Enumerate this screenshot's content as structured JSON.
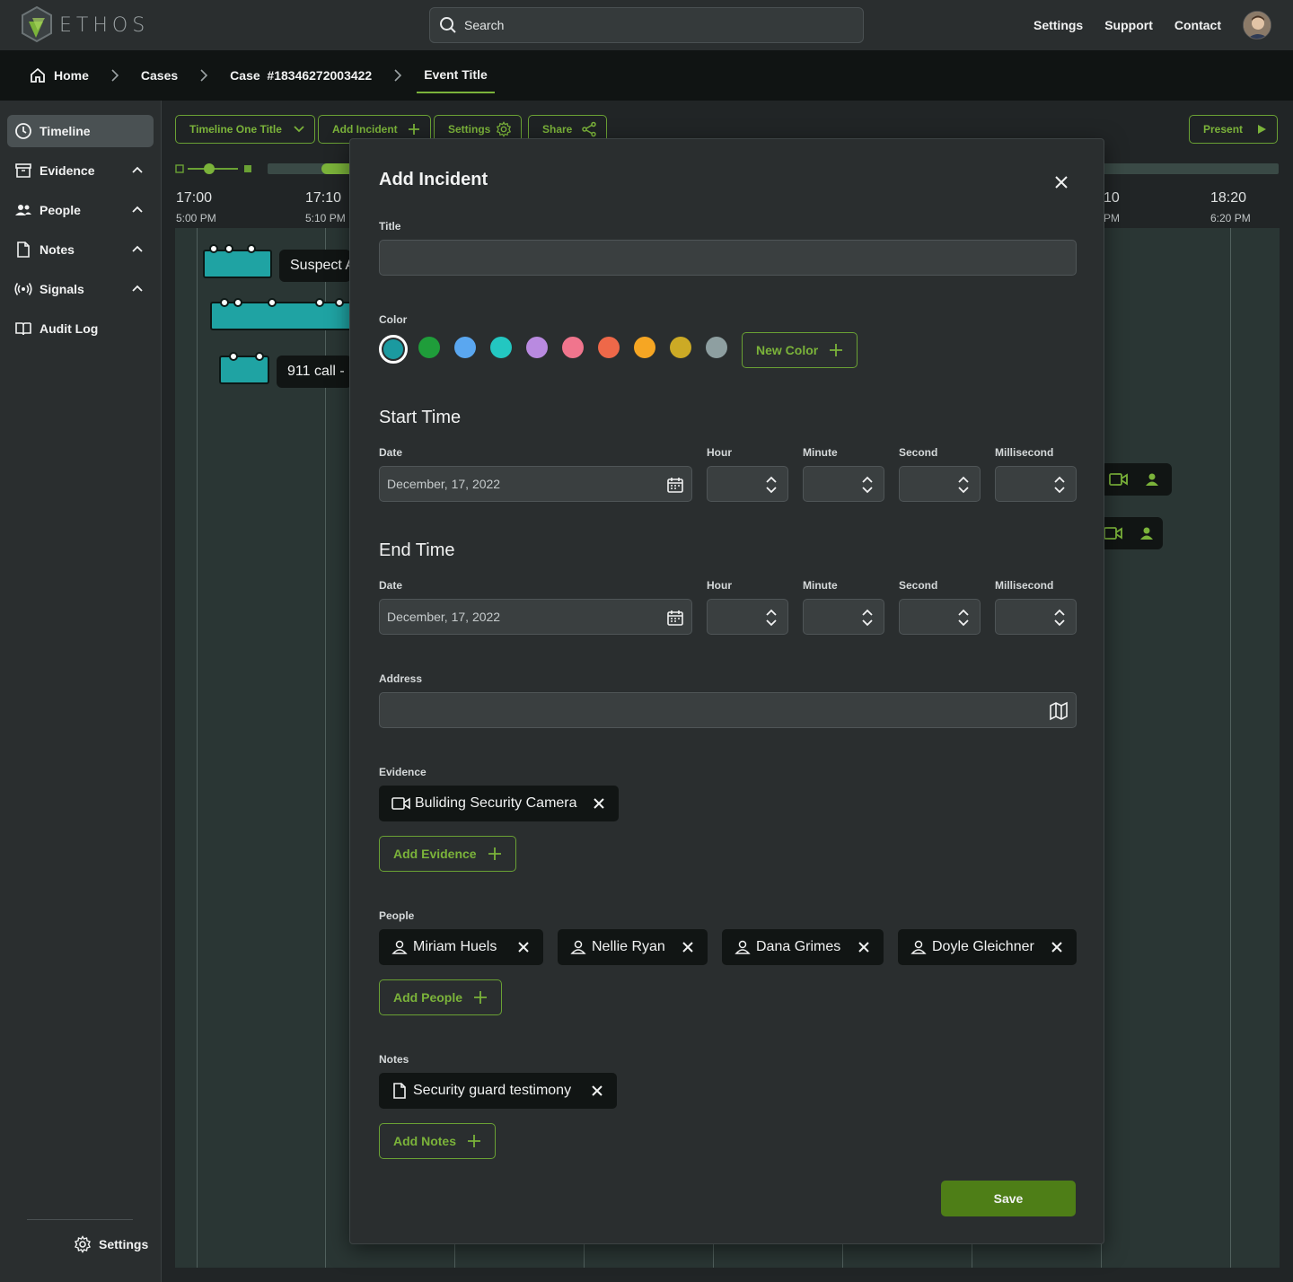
{
  "app": {
    "name": "ETHOS"
  },
  "search": {
    "placeholder": "Search"
  },
  "toplinks": [
    "Settings",
    "Support",
    "Contact"
  ],
  "breadcrumbs": [
    "Home",
    "Cases",
    "Case  #18346272003422",
    "Event Title"
  ],
  "sidebar": {
    "items": [
      {
        "label": "Timeline",
        "icon": "clock-icon",
        "active": true
      },
      {
        "label": "Evidence",
        "icon": "archive-icon",
        "expandable": true
      },
      {
        "label": "People",
        "icon": "people-icon",
        "expandable": true
      },
      {
        "label": "Notes",
        "icon": "document-icon",
        "expandable": true
      },
      {
        "label": "Signals",
        "icon": "signal-icon",
        "expandable": true
      },
      {
        "label": "Audit Log",
        "icon": "book-icon"
      }
    ],
    "settings_label": "Settings"
  },
  "toolbar": {
    "timeline_title": "Timeline One Title",
    "add_incident": "Add Incident",
    "settings": "Settings",
    "share": "Share",
    "present": "Present"
  },
  "timeline": {
    "times": [
      {
        "time": "17:00",
        "sub": "5:00 PM"
      },
      {
        "time": "17:10",
        "sub": "5:10 PM"
      },
      {
        "time": "10",
        "sub": "PM"
      },
      {
        "time": "18:20",
        "sub": "6:20 PM"
      }
    ],
    "labels": [
      "Suspect A",
      "911 call -"
    ]
  },
  "modal": {
    "title": "Add Incident",
    "title_label": "Title",
    "title_value": "",
    "color_label": "Color",
    "colors": [
      "#1b9aa0",
      "#1f9d3a",
      "#5aa7f0",
      "#23c7c1",
      "#b98ae0",
      "#f0758d",
      "#ee6849",
      "#f6a623",
      "#ccaa25",
      "#8e9fa1"
    ],
    "new_color": "New Color",
    "start_time": {
      "heading": "Start Time",
      "date_label": "Date",
      "date": "December, 17, 2022",
      "hour_label": "Hour",
      "minute_label": "Minute",
      "second_label": "Second",
      "ms_label": "Millisecond"
    },
    "end_time": {
      "heading": "End Time",
      "date_label": "Date",
      "date": "December, 17, 2022",
      "hour_label": "Hour",
      "minute_label": "Minute",
      "second_label": "Second",
      "ms_label": "Millisecond"
    },
    "address_label": "Address",
    "evidence_label": "Evidence",
    "evidence": [
      "Buliding Security Camera"
    ],
    "add_evidence": "Add Evidence",
    "people_label": "People",
    "people": [
      "Miriam Huels",
      "Nellie Ryan",
      "Dana Grimes",
      "Doyle Gleichner"
    ],
    "add_people": "Add People",
    "notes_label": "Notes",
    "notes": [
      "Security guard testimony"
    ],
    "add_notes": "Add Notes",
    "save": "Save"
  }
}
